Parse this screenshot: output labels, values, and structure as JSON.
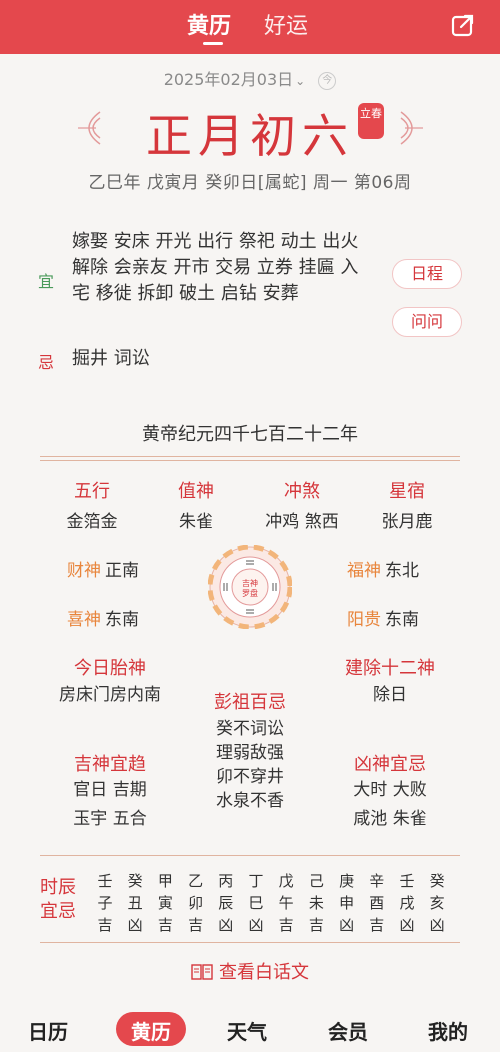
{
  "header": {
    "tabs": [
      "黄历",
      "好运"
    ],
    "share_icon": "share-icon"
  },
  "date": {
    "text": "2025年02月03日",
    "chevron": "⌄",
    "today_badge": "今"
  },
  "lunar": {
    "title": "正月初六",
    "jieqi": "立春"
  },
  "ganzhi": "乙巳年 戊寅月 癸卯日[属蛇] 周一 第06周",
  "yiji": {
    "yi_label": "宜",
    "yi_text": "嫁娶 安床 开光 出行 祭祀 动土 出火 解除 会亲友 开市 交易 立券 挂匾 入宅 移徙 拆卸 破土 启钻 安葬",
    "ji_label": "忌",
    "ji_text": "掘井 词讼",
    "schedule_button": "日程",
    "ask_button": "问问"
  },
  "huangdi": "黄帝纪元四千七百二十二年",
  "info4": [
    {
      "title": "五行",
      "value": "金箔金"
    },
    {
      "title": "值神",
      "value": "朱雀"
    },
    {
      "title": "冲煞",
      "value": "冲鸡 煞西"
    },
    {
      "title": "星宿",
      "value": "张月鹿"
    }
  ],
  "gods": {
    "caishen": {
      "k": "财神",
      "v": "正南"
    },
    "fushen": {
      "k": "福神",
      "v": "东北"
    },
    "xishen": {
      "k": "喜神",
      "v": "东南"
    },
    "yanggui": {
      "k": "阳贵",
      "v": "东南"
    }
  },
  "compass_center": "吉神罗盘",
  "taishen": {
    "title": "今日胎神",
    "value": "房床门房内南"
  },
  "jianchu": {
    "title": "建除十二神",
    "value": "除日"
  },
  "pengzu": {
    "title": "彭祖百忌",
    "lines": [
      "癸不词讼",
      "理弱敌强",
      "卯不穿井",
      "水泉不香"
    ]
  },
  "jishen": {
    "title": "吉神宜趋",
    "lines": [
      "官日 吉期",
      "玉宇 五合"
    ]
  },
  "xiongshen": {
    "title": "凶神宜忌",
    "lines": [
      "大时 大败",
      "咸池 朱雀"
    ]
  },
  "shichen": {
    "label": "时辰宜忌",
    "hours": [
      [
        "壬",
        "子",
        "吉"
      ],
      [
        "癸",
        "丑",
        "凶"
      ],
      [
        "甲",
        "寅",
        "吉"
      ],
      [
        "乙",
        "卯",
        "吉"
      ],
      [
        "丙",
        "辰",
        "凶"
      ],
      [
        "丁",
        "巳",
        "凶"
      ],
      [
        "戊",
        "午",
        "吉"
      ],
      [
        "己",
        "未",
        "吉"
      ],
      [
        "庚",
        "申",
        "凶"
      ],
      [
        "辛",
        "酉",
        "吉"
      ],
      [
        "壬",
        "戌",
        "凶"
      ],
      [
        "癸",
        "亥",
        "凶"
      ]
    ]
  },
  "vernacular_link": "查看白话文",
  "nav": [
    "日历",
    "黄历",
    "天气",
    "会员",
    "我的"
  ],
  "colors": {
    "brand": "#e4484d",
    "ji": "#d5363b",
    "yi": "#4a9a5a",
    "orange": "#e8853c"
  }
}
